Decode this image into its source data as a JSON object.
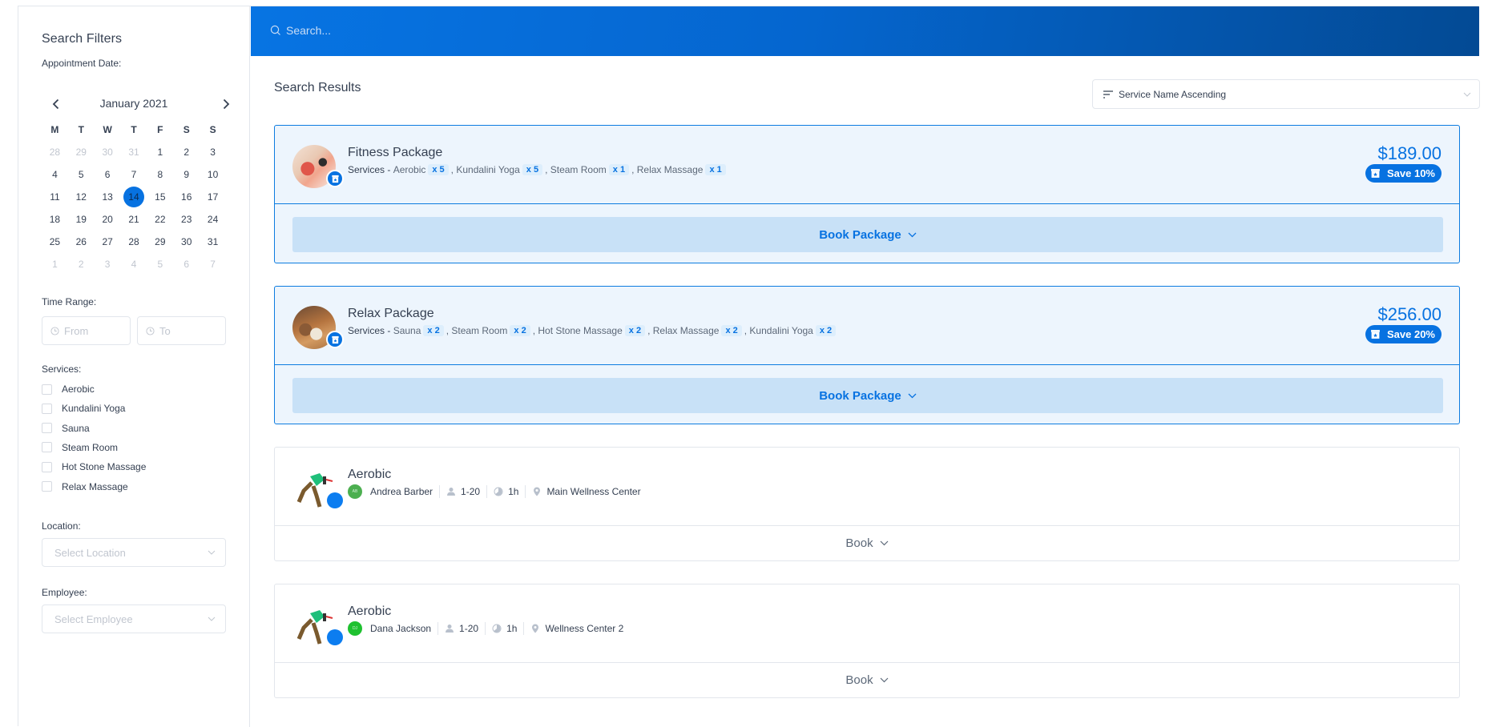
{
  "sidebar": {
    "title": "Search Filters",
    "appointment_label": "Appointment Date:",
    "calendar": {
      "month_label": "January 2021",
      "weekdays": [
        "M",
        "T",
        "W",
        "T",
        "F",
        "S",
        "S"
      ],
      "weeks": [
        [
          {
            "d": "28",
            "muted": true
          },
          {
            "d": "29",
            "muted": true
          },
          {
            "d": "30",
            "muted": true
          },
          {
            "d": "31",
            "muted": true
          },
          {
            "d": "1"
          },
          {
            "d": "2"
          },
          {
            "d": "3"
          }
        ],
        [
          {
            "d": "4"
          },
          {
            "d": "5"
          },
          {
            "d": "6"
          },
          {
            "d": "7"
          },
          {
            "d": "8"
          },
          {
            "d": "9"
          },
          {
            "d": "10"
          }
        ],
        [
          {
            "d": "11"
          },
          {
            "d": "12"
          },
          {
            "d": "13"
          },
          {
            "d": "14",
            "selected": true
          },
          {
            "d": "15"
          },
          {
            "d": "16"
          },
          {
            "d": "17"
          }
        ],
        [
          {
            "d": "18"
          },
          {
            "d": "19"
          },
          {
            "d": "20"
          },
          {
            "d": "21"
          },
          {
            "d": "22"
          },
          {
            "d": "23"
          },
          {
            "d": "24"
          }
        ],
        [
          {
            "d": "25"
          },
          {
            "d": "26"
          },
          {
            "d": "27"
          },
          {
            "d": "28"
          },
          {
            "d": "29"
          },
          {
            "d": "30"
          },
          {
            "d": "31"
          }
        ],
        [
          {
            "d": "1",
            "muted": true
          },
          {
            "d": "2",
            "muted": true
          },
          {
            "d": "3",
            "muted": true
          },
          {
            "d": "4",
            "muted": true
          },
          {
            "d": "5",
            "muted": true
          },
          {
            "d": "6",
            "muted": true
          },
          {
            "d": "7",
            "muted": true
          }
        ]
      ],
      "selected_day": "14"
    },
    "time_range_label": "Time Range:",
    "time_from_placeholder": "From",
    "time_to_placeholder": "To",
    "services_label": "Services:",
    "services": [
      "Aerobic",
      "Kundalini Yoga",
      "Sauna",
      "Steam Room",
      "Hot Stone Massage",
      "Relax Massage"
    ],
    "location_label": "Location:",
    "location_placeholder": "Select Location",
    "employee_label": "Employee:",
    "employee_placeholder": "Select Employee"
  },
  "header": {
    "search_placeholder": "Search..."
  },
  "main": {
    "results_title": "Search Results",
    "sort_value": "Service Name Ascending",
    "packages": [
      {
        "name": "Fitness Package",
        "services_lead": "Services - ",
        "services": [
          {
            "name": "Aerobic",
            "qty": "x 5"
          },
          {
            "name": "Kundalini Yoga",
            "qty": "x 5"
          },
          {
            "name": "Steam Room",
            "qty": "x 1"
          },
          {
            "name": "Relax Massage",
            "qty": "x 1"
          }
        ],
        "price": "$189.00",
        "save": "Save 10%",
        "book_label": "Book Package"
      },
      {
        "name": "Relax Package",
        "services_lead": "Services - ",
        "services": [
          {
            "name": "Sauna",
            "qty": "x 2"
          },
          {
            "name": "Steam Room",
            "qty": "x 2"
          },
          {
            "name": "Hot Stone Massage",
            "qty": "x 2"
          },
          {
            "name": "Relax Massage",
            "qty": "x 2"
          },
          {
            "name": "Kundalini Yoga",
            "qty": "x 2"
          }
        ],
        "price": "$256.00",
        "save": "Save 20%",
        "book_label": "Book Package"
      }
    ],
    "services": [
      {
        "name": "Aerobic",
        "employee": "Andrea Barber",
        "employee_initials": "AB",
        "employee_color": "#4caf50",
        "capacity": "1-20",
        "duration": "1h",
        "location": "Main Wellness Center",
        "book_label": "Book"
      },
      {
        "name": "Aerobic",
        "employee": "Dana Jackson",
        "employee_initials": "DJ",
        "employee_color": "#1fc130",
        "capacity": "1-20",
        "duration": "1h",
        "location": "Wellness Center 2",
        "book_label": "Book"
      }
    ]
  },
  "colors": {
    "accent": "#0772e1",
    "package_bg": "#edf5fd",
    "book_package_bg": "#c8e1f7"
  }
}
